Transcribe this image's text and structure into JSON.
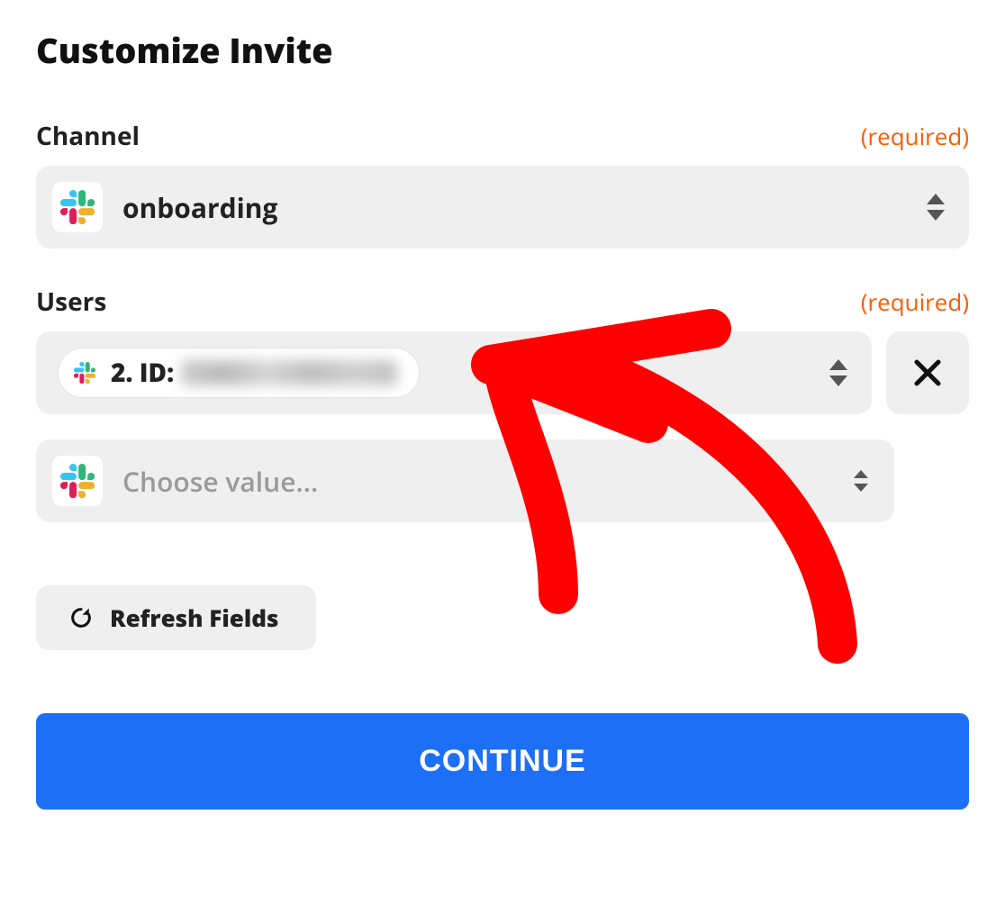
{
  "section_title": "Customize Invite",
  "required_label": "(required)",
  "channel": {
    "label": "Channel",
    "value": "onboarding"
  },
  "users": {
    "label": "Users",
    "entries": [
      {
        "prefix": "2. ID:"
      }
    ],
    "placeholder": "Choose value..."
  },
  "refresh_label": "Refresh Fields",
  "continue_label": "CONTINUE",
  "icons": {
    "app": "slack-icon",
    "sort": "sort-icon",
    "remove": "close-icon",
    "refresh": "refresh-icon"
  }
}
